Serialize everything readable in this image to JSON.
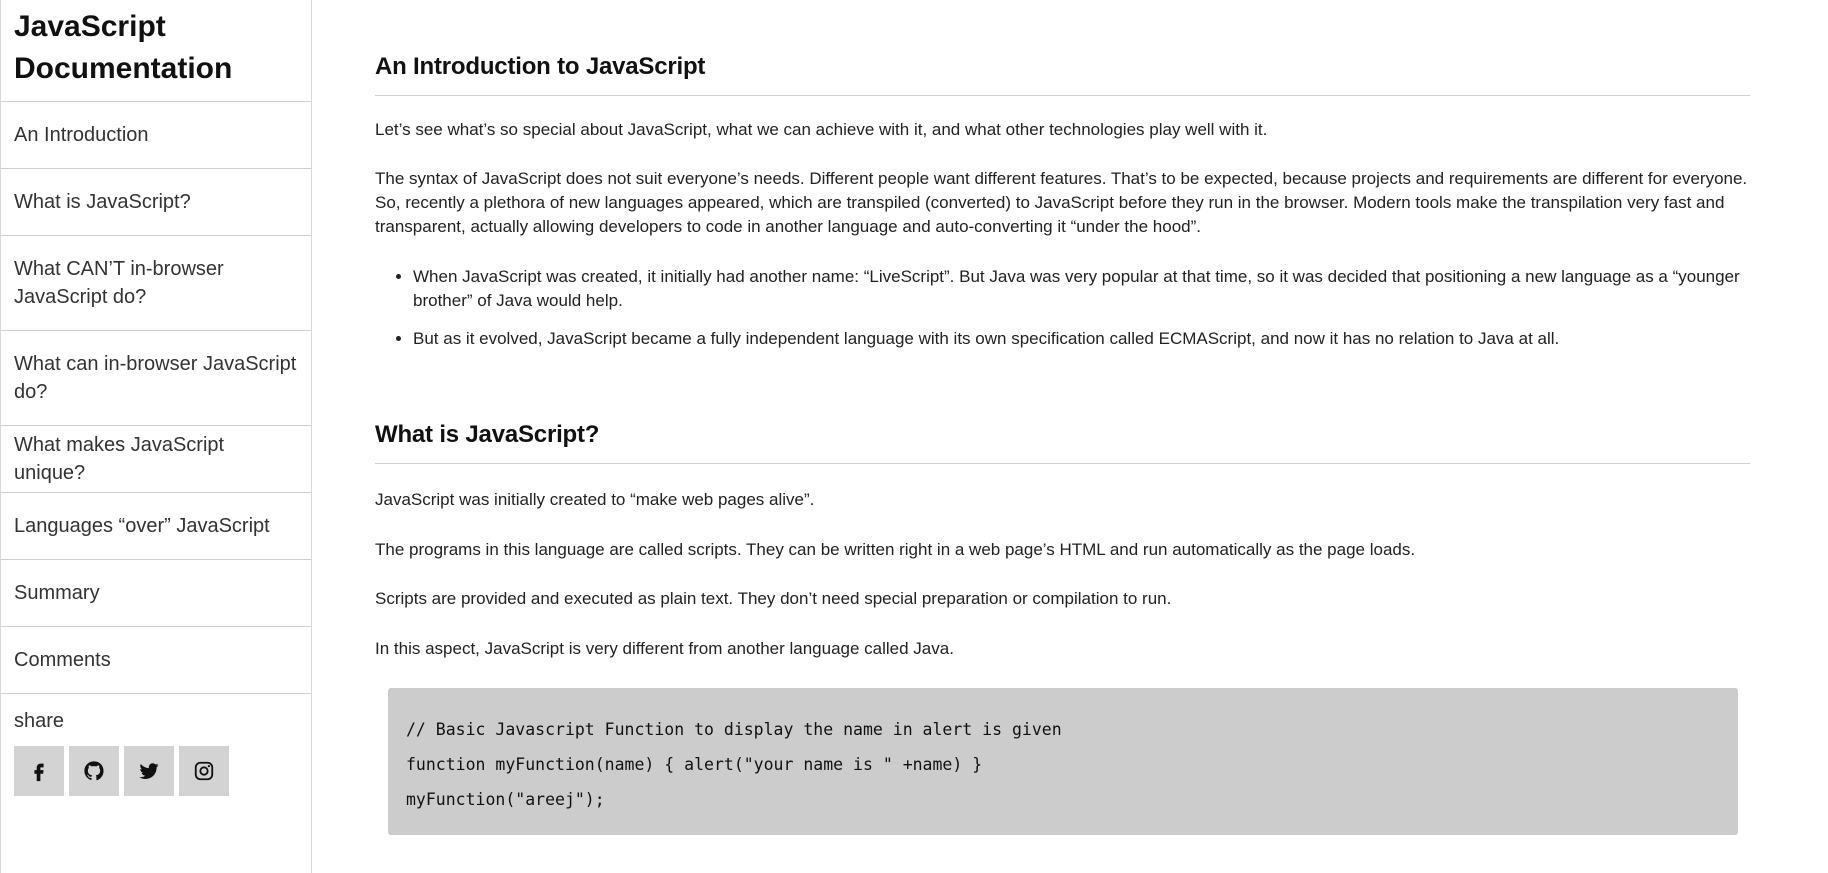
{
  "sidebar": {
    "header": "JavaScript Documentation",
    "links": [
      {
        "label": "An Introduction"
      },
      {
        "label": "What is JavaScript?"
      },
      {
        "label": "What CAN’T in-browser JavaScript do?"
      },
      {
        "label": "What can in-browser JavaScript do?"
      },
      {
        "label": "What makes JavaScript unique?"
      },
      {
        "label": "Languages “over” JavaScript"
      },
      {
        "label": "Summary"
      },
      {
        "label": "Comments"
      }
    ],
    "share_label": "share",
    "share_icons": [
      "facebook-icon",
      "github-icon",
      "twitter-icon",
      "instagram-icon"
    ]
  },
  "sections": [
    {
      "title": "An Introduction to JavaScript",
      "paragraphs": [
        "Let’s see what’s so special about JavaScript, what we can achieve with it, and what other technologies play well with it.",
        "The syntax of JavaScript does not suit everyone’s needs. Different people want different features. That’s to be expected, because projects and requirements are different for everyone. So, recently a plethora of new languages appeared, which are transpiled (converted) to JavaScript before they run in the browser. Modern tools make the transpilation very fast and transparent, actually allowing developers to code in another language and auto-converting it “under the hood”."
      ],
      "bullets": [
        "When JavaScript was created, it initially had another name: “LiveScript”. But Java was very popular at that time, so it was decided that positioning a new language as a “younger brother” of Java would help.",
        "But as it evolved, JavaScript became a fully independent language with its own specification called ECMAScript, and now it has no relation to Java at all."
      ]
    },
    {
      "title": "What is JavaScript?",
      "paragraphs": [
        "JavaScript was initially created to “make web pages alive”.",
        "The programs in this language are called scripts. They can be written right in a web page’s HTML and run automatically as the page loads.",
        "Scripts are provided and executed as plain text. They don’t need special preparation or compilation to run.",
        "In this aspect, JavaScript is very different from another language called Java."
      ],
      "code": [
        "// Basic Javascript Function to display the name in alert is given",
        "function myFunction(name) { alert(\"your name is \" +name) }",
        "myFunction(\"areej\");"
      ]
    }
  ]
}
